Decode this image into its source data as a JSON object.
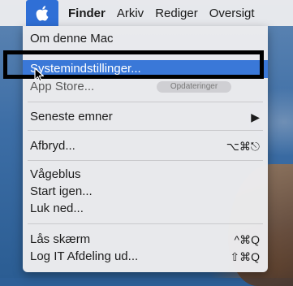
{
  "menubar": {
    "apple_icon": "apple-logo-icon",
    "items": [
      "Finder",
      "Arkiv",
      "Rediger",
      "Oversigt"
    ]
  },
  "menu": {
    "about": "Om denne Mac",
    "system_prefs": "Systemindstillinger...",
    "app_store": "App Store...",
    "app_store_badge": "Opdateringer",
    "recent": "Seneste emner",
    "recent_arrow": "▶",
    "force_quit": "Afbryd...",
    "force_quit_shortcut": "⌥⌘⎋",
    "sleep": "Vågeblus",
    "restart": "Start igen...",
    "shutdown": "Luk ned...",
    "lock": "Lås skærm",
    "lock_shortcut": "^⌘Q",
    "logout": "Log IT Afdeling ud...",
    "logout_shortcut": "⇧⌘Q"
  },
  "colors": {
    "highlight": "#3a78d8",
    "apple_menu_active": "#2f6fd6",
    "annotation_box": "#000000"
  }
}
